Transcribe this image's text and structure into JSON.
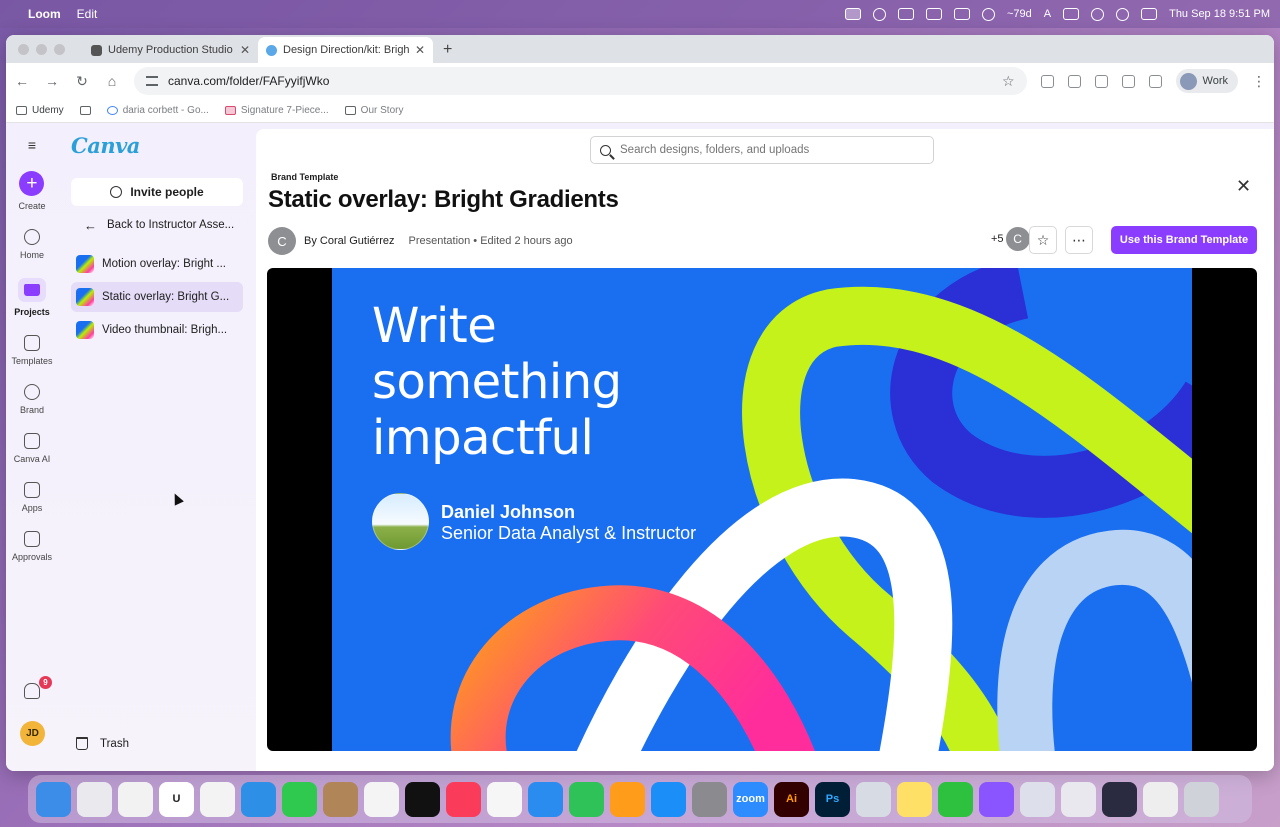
{
  "menubar": {
    "app": "Loom",
    "items": [
      "Edit"
    ],
    "battery_text": "~79d",
    "input_source": "A",
    "clock": "Thu Sep 18  9:51 PM"
  },
  "tabs": [
    {
      "title": "Udemy Production Studio | Tr",
      "active": false
    },
    {
      "title": "Design Direction/kit: Bright G",
      "active": true
    }
  ],
  "toolbar": {
    "url": "canva.com/folder/FAFyyifjWko",
    "profile": "Work"
  },
  "bookmarks": [
    "Udemy",
    "daria corbett - Go...",
    "Signature 7-Piece...",
    "Our Story"
  ],
  "rail": {
    "items": [
      {
        "label": "Create"
      },
      {
        "label": "Home"
      },
      {
        "label": "Projects"
      },
      {
        "label": "Templates"
      },
      {
        "label": "Brand"
      },
      {
        "label": "Canva AI"
      },
      {
        "label": "Apps"
      },
      {
        "label": "Approvals"
      }
    ],
    "notification_count": "9",
    "user_initials": "JD"
  },
  "sidepanel": {
    "logo": "Canva",
    "invite": "Invite people",
    "back": "Back to Instructor Asse...",
    "items": [
      {
        "label": "Motion overlay: Bright ..."
      },
      {
        "label": "Static overlay: Bright G..."
      },
      {
        "label": "Video thumbnail: Brigh..."
      }
    ],
    "trash": "Trash"
  },
  "main": {
    "search_placeholder": "Search designs, folders, and uploads",
    "kicker": "Brand Template",
    "title": "Static overlay: Bright Gradients",
    "author_initial": "C",
    "author": "By Coral Gutiérrez",
    "meta": "Presentation • Edited 2 hours ago",
    "collab_count": "+5",
    "collab_initial": "C",
    "use_button": "Use this Brand Template"
  },
  "slide": {
    "headline": [
      "Write",
      "something",
      "impactful"
    ],
    "name": "Daniel Johnson",
    "role": "Senior Data Analyst & Instructor",
    "colors": {
      "background": "#1a6ff0",
      "lime": "#c4f21a",
      "navy": "#2b2fd6",
      "white": "#ffffff",
      "light_blue": "#b9d3f5",
      "pink": "#ff2d9b",
      "orange": "#ff9a1f"
    }
  },
  "dock": {
    "zoom_label": "zoom",
    "ai_label": "Ai",
    "ps_label": "Ps"
  }
}
